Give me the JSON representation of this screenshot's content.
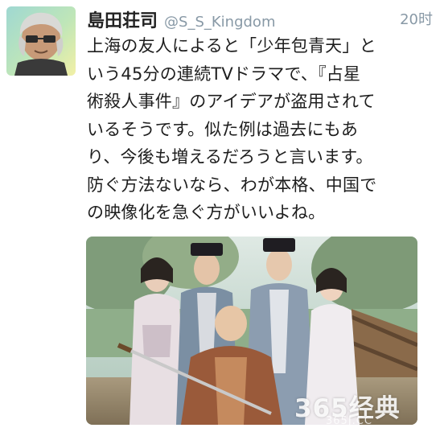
{
  "tweet": {
    "display_name": "島田荘司",
    "handle": "@S_S_Kingdom",
    "timestamp": "20时",
    "text_lines": [
      "上海の友人によると「少年包青天」と",
      "いう45分の連続TVドラマで、『占星",
      "術殺人事件』のアイデアが盗用されて",
      "いるそうです。似た例は過去にもあ",
      "り、今後も増えるだろうと言います。",
      "防ぐ方法ないなら、わが本格、中国で",
      "の映像化を急ぐ方がいいよね。"
    ]
  },
  "avatar_icon": "profile-photo-icon",
  "media_icon": "drama-cast-photo",
  "watermark": {
    "main": "365经典",
    "sub": "365J.CC"
  },
  "colors": {
    "handle_gray": "#8899a6",
    "text": "#1e1e1e",
    "background": "#ffffff"
  }
}
